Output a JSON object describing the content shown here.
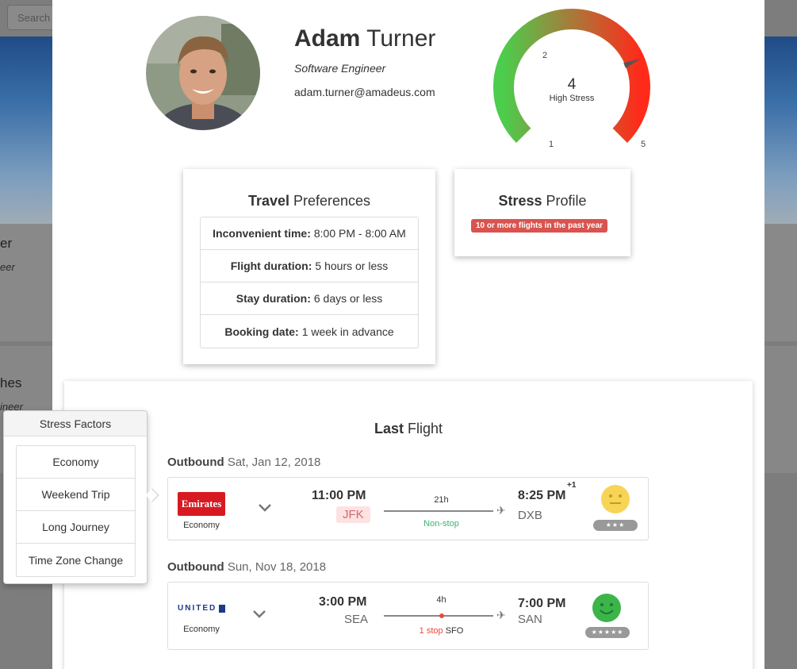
{
  "background": {
    "search_placeholder": "Search",
    "card1_title": "er",
    "card1_subtitle": "eer",
    "card2_title": "hes",
    "card2_subtitle": "ineer"
  },
  "profile": {
    "first_name": "Adam",
    "last_name": "Turner",
    "job_title": "Software Engineer",
    "email": "adam.turner@amadeus.com"
  },
  "gauge": {
    "value": "4",
    "label": "High Stress",
    "min": "1",
    "tick2": "2",
    "max": "5",
    "level": 4,
    "range": [
      1,
      5
    ]
  },
  "preferences": {
    "title_bold": "Travel",
    "title_rest": "Preferences",
    "rows": [
      {
        "label": "Inconvenient time:",
        "value": "8:00 PM - 8:00 AM"
      },
      {
        "label": "Flight duration:",
        "value": "5 hours or less"
      },
      {
        "label": "Stay duration:",
        "value": "6 days or less"
      },
      {
        "label": "Booking date:",
        "value": "1 week in advance"
      }
    ]
  },
  "stress_profile": {
    "title_bold": "Stress",
    "title_rest": "Profile",
    "badge": "10 or more flights in the past year"
  },
  "last_flight": {
    "title_bold": "Last",
    "title_rest": "Flight",
    "segments": [
      {
        "direction": "Outbound",
        "date": "Sat, Jan 12, 2018",
        "airline": "Emirates",
        "cabin": "Economy",
        "dep_time": "11:00 PM",
        "dep_code": "JFK",
        "arr_time": "8:25 PM",
        "arr_code": "DXB",
        "day_offset": "+1",
        "duration": "21h",
        "stops": "Non-stop",
        "stars": "★★★",
        "rating": 3
      },
      {
        "direction": "Outbound",
        "date": "Sun, Nov 18, 2018",
        "airline": "UNITED",
        "cabin": "Economy",
        "dep_time": "3:00 PM",
        "dep_code": "SEA",
        "arr_time": "7:00 PM",
        "arr_code": "SAN",
        "duration": "4h",
        "stops_count": "1 stop",
        "stop_code": "SFO",
        "stars": "★★★★★",
        "rating": 5
      }
    ]
  },
  "stress_factors": {
    "title": "Stress Factors",
    "items": [
      "Economy",
      "Weekend Trip",
      "Long Journey",
      "Time Zone Change"
    ]
  },
  "colors": {
    "gauge_green": "#4ccd4c",
    "gauge_red": "#ff2a1a",
    "badge_red": "#d9534f",
    "nonstop_green": "#3cb371",
    "emirates_red": "#d71921",
    "united_blue": "#1b3a8a"
  }
}
